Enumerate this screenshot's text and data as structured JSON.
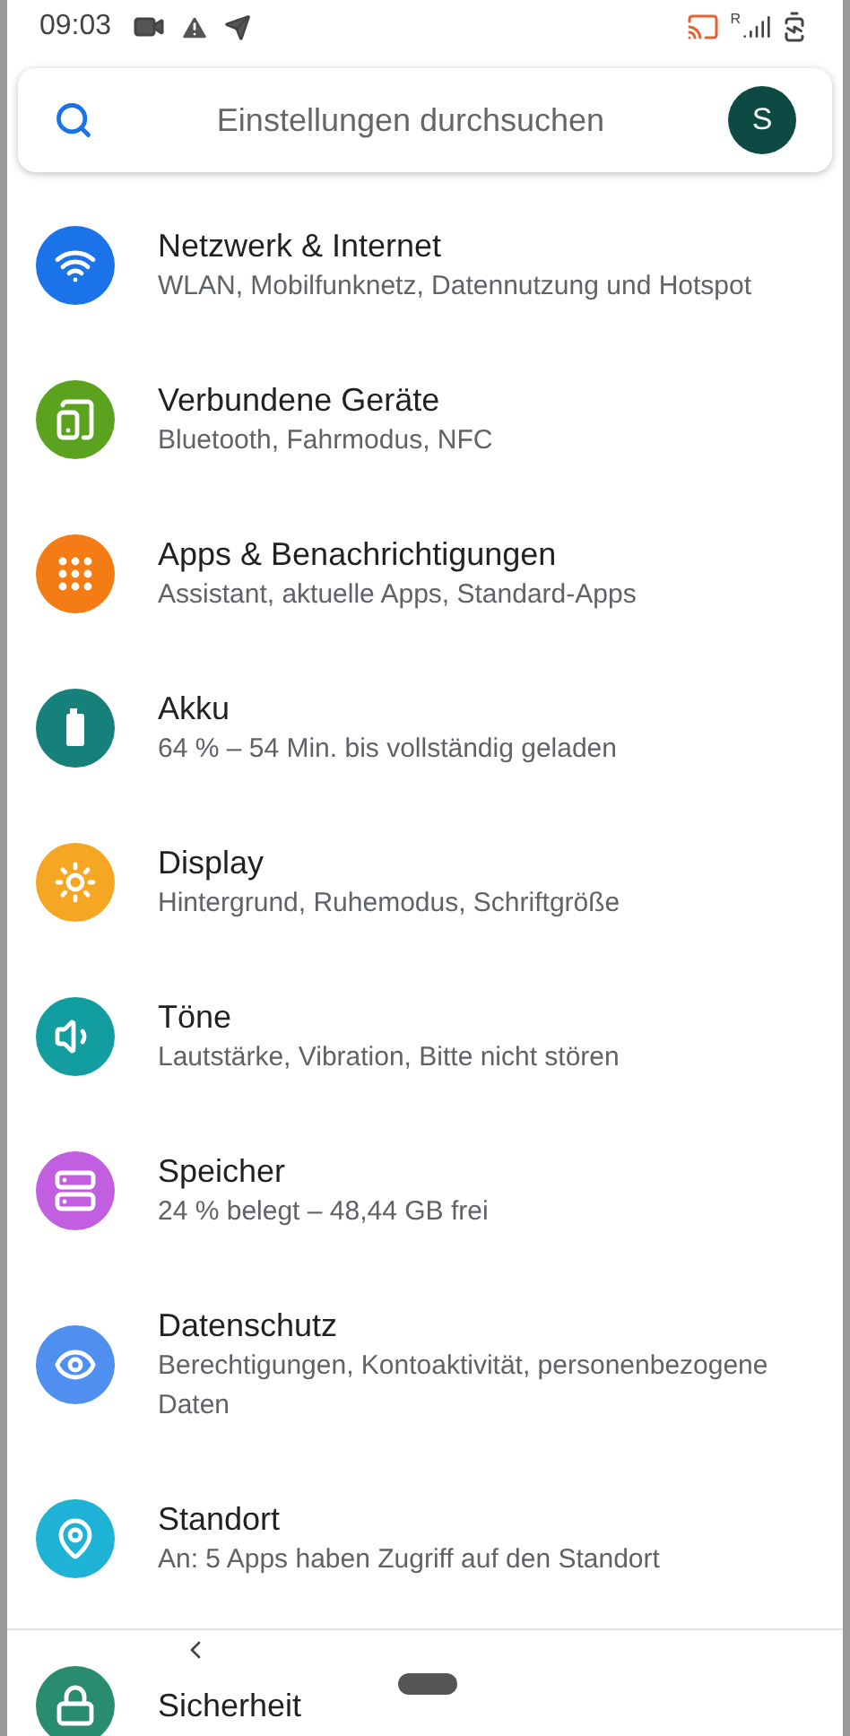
{
  "status_bar": {
    "time": "09:03",
    "roaming": "R"
  },
  "search": {
    "placeholder": "Einstellungen durchsuchen",
    "avatar": "S"
  },
  "items": [
    {
      "kind": "wifi",
      "color": "#1a73e8",
      "title": "Netzwerk & Internet",
      "subtitle": "WLAN, Mobilfunknetz, Datennutzung und Hotspot"
    },
    {
      "kind": "devices",
      "color": "#5ba31f",
      "title": "Verbundene Geräte",
      "subtitle": "Bluetooth, Fahrmodus, NFC"
    },
    {
      "kind": "apps",
      "color": "#f57c14",
      "title": "Apps & Benachrichtigungen",
      "subtitle": "Assistant, aktuelle Apps, Standard-Apps"
    },
    {
      "kind": "battery",
      "color": "#16807a",
      "title": "Akku",
      "subtitle": "64 % – 54 Min. bis vollständig geladen"
    },
    {
      "kind": "display",
      "color": "#f5a623",
      "title": "Display",
      "subtitle": "Hintergrund, Ruhemodus, Schriftgröße"
    },
    {
      "kind": "sound",
      "color": "#129ea0",
      "title": "Töne",
      "subtitle": "Lautstärke, Vibration, Bitte nicht stören"
    },
    {
      "kind": "storage",
      "color": "#c25ee0",
      "title": "Speicher",
      "subtitle": "24 % belegt – 48,44 GB frei"
    },
    {
      "kind": "privacy",
      "color": "#4f8ff0",
      "title": "Datenschutz",
      "subtitle": "Berechtigungen, Kontoaktivität, personenbezogene Daten"
    },
    {
      "kind": "location",
      "color": "#1eb3d6",
      "title": "Standort",
      "subtitle": "An: 5 Apps haben Zugriff auf den Standort"
    },
    {
      "kind": "security",
      "color": "#2a8c6e",
      "title": "Sicherheit"
    }
  ]
}
